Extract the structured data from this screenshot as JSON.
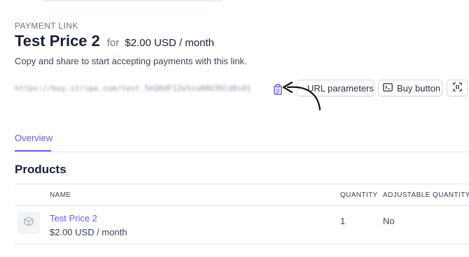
{
  "header": {
    "kicker": "PAYMENT LINK",
    "title": "Test Price 2",
    "for_word": "for",
    "price": "$2.00 USD / month",
    "subtitle": "Copy and share to start accepting payments with this link."
  },
  "link": {
    "url_blurred": "https://buy.stripe.com/test_5kQ0dF12e5zu00U36Cd8s01"
  },
  "toolbar": {
    "url_parameters_label": "URL parameters",
    "buy_button_label": "Buy button",
    "qr_icon": "qr-code-icon"
  },
  "tabs": [
    {
      "label": "Overview",
      "active": true
    }
  ],
  "products": {
    "title": "Products",
    "columns": [
      "NAME",
      "QUANTITY",
      "ADJUSTABLE QUANTITY"
    ],
    "rows": [
      {
        "name": "Test Price 2",
        "price": "$2.00 USD / month",
        "quantity": "1",
        "adjustable": "No"
      }
    ]
  },
  "colors": {
    "accent": "#635bff",
    "text": "#1a1f36",
    "muted": "#697386",
    "border": "#e3e8ee"
  },
  "icons": {
    "copy": "clipboard-icon",
    "buy_button": "code-window-icon",
    "qr": "qr-code-icon",
    "product": "box-icon",
    "annotation": "curved-arrow-icon"
  }
}
